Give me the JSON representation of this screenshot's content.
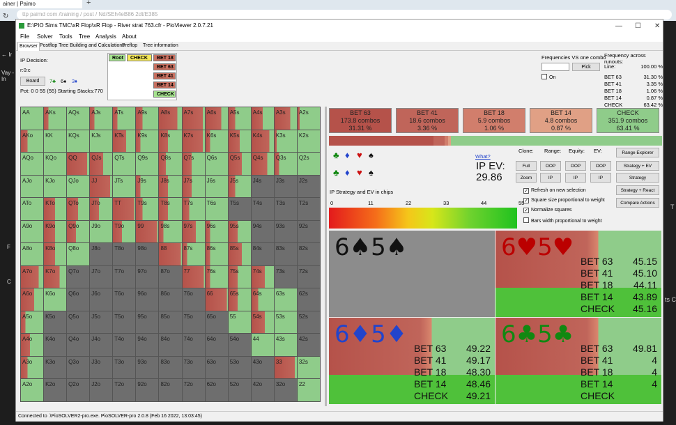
{
  "browser": {
    "tab_title": "ainer | Paimo",
    "url": "ttp  paimd  com /training / post / Nd/SEh4eB86  2dt/E385"
  },
  "left_strip": [
    "← Ir",
    "Vay - In",
    "F",
    "C"
  ],
  "right_strip": [
    "T",
    "ts C"
  ],
  "window": {
    "title": "E:\\PIO Sims TMC\\xR Flop\\xR Flop - River strat 763.cfr - PioViewer 2.0.7.21",
    "controls": [
      "—",
      "☐",
      "✕"
    ]
  },
  "menu": [
    "File",
    "Solver",
    "Tools",
    "Tree",
    "Analysis",
    "About"
  ],
  "tabs": [
    "Browser",
    "Postflop Tree Building and Calculations",
    "Preflop",
    "Tree information"
  ],
  "info": {
    "decision": "IP Decision:",
    "node": "r:0:c",
    "board_btn": "Board",
    "board_cards": [
      "7♣",
      "6♠",
      "3♦"
    ],
    "pot": "Pot: 0 0 55 (55) Starting Stacks:770"
  },
  "tree": {
    "root": "Root",
    "check": "CHECK",
    "bets": [
      "BET 18",
      "BET 63",
      "BET 41",
      "BET 14"
    ],
    "check2": "CHECK"
  },
  "freq_panel": {
    "vs_combo": "Frequencies VS one combo",
    "pick": "Pick",
    "on": "On",
    "across": "Frequency across runouts:",
    "line_label": "Line:",
    "line_value": "100.00 %",
    "rows": [
      {
        "label": "BET 63",
        "value": "31.30 %"
      },
      {
        "label": "BET 41",
        "value": "3.35 %"
      },
      {
        "label": "BET 18",
        "value": "1.06 %"
      },
      {
        "label": "BET 14",
        "value": "0.87 %"
      },
      {
        "label": "CHECK",
        "value": "63.42 %"
      }
    ]
  },
  "hands": [
    [
      "AA",
      "AKs",
      "AQs",
      "AJs",
      "ATs",
      "A9s",
      "A8s",
      "A7s",
      "A6s",
      "A5s",
      "A4s",
      "A3s",
      "A2s"
    ],
    [
      "AKo",
      "KK",
      "KQs",
      "KJs",
      "KTs",
      "K9s",
      "K8s",
      "K7s",
      "K6s",
      "K5s",
      "K4s",
      "K3s",
      "K2s"
    ],
    [
      "AQo",
      "KQo",
      "QQ",
      "QJs",
      "QTs",
      "Q9s",
      "Q8s",
      "Q7s",
      "Q6s",
      "Q5s",
      "Q4s",
      "Q3s",
      "Q2s"
    ],
    [
      "AJo",
      "KJo",
      "QJo",
      "JJ",
      "JTs",
      "J9s",
      "J8s",
      "J7s",
      "J6s",
      "J5s",
      "J4s",
      "J3s",
      "J2s"
    ],
    [
      "ATo",
      "KTo",
      "QTo",
      "JTo",
      "TT",
      "T9s",
      "T8s",
      "T7s",
      "T6s",
      "T5s",
      "T4s",
      "T3s",
      "T2s"
    ],
    [
      "A9o",
      "K9o",
      "Q9o",
      "J9o",
      "T9o",
      "99",
      "98s",
      "97s",
      "96s",
      "95s",
      "94s",
      "93s",
      "92s"
    ],
    [
      "A8o",
      "K8o",
      "Q8o",
      "J8o",
      "T8o",
      "98o",
      "88",
      "87s",
      "86s",
      "85s",
      "84s",
      "83s",
      "82s"
    ],
    [
      "A7o",
      "K7o",
      "Q7o",
      "J7o",
      "T7o",
      "97o",
      "87o",
      "77",
      "76s",
      "75s",
      "74s",
      "73s",
      "72s"
    ],
    [
      "A6o",
      "K6o",
      "Q6o",
      "J6o",
      "T6o",
      "96o",
      "86o",
      "76o",
      "66",
      "65s",
      "64s",
      "63s",
      "62s"
    ],
    [
      "A5o",
      "K5o",
      "Q5o",
      "J5o",
      "T5o",
      "95o",
      "85o",
      "75o",
      "65o",
      "55",
      "54s",
      "53s",
      "52s"
    ],
    [
      "A4o",
      "K4o",
      "Q4o",
      "J4o",
      "T4o",
      "94o",
      "84o",
      "74o",
      "64o",
      "54o",
      "44",
      "43s",
      "42s"
    ],
    [
      "A3o",
      "K3o",
      "Q3o",
      "J3o",
      "T3o",
      "93o",
      "83o",
      "73o",
      "63o",
      "53o",
      "43o",
      "33",
      "32s"
    ],
    [
      "A2o",
      "K2o",
      "Q2o",
      "J2o",
      "T2o",
      "92o",
      "82o",
      "72o",
      "62o",
      "52o",
      "42o",
      "32o",
      "22"
    ]
  ],
  "actions": [
    {
      "label": "BET 63",
      "combos": "173.8 combos",
      "pct": "31.31 %",
      "freq": 31.31,
      "color": "#b5524a"
    },
    {
      "label": "BET 41",
      "combos": "18.6 combos",
      "pct": "3.36 %",
      "freq": 3.36,
      "color": "#c0655a"
    },
    {
      "label": "BET 18",
      "combos": "5.9 combos",
      "pct": "1.06 %",
      "freq": 1.06,
      "color": "#d17e6c"
    },
    {
      "label": "BET 14",
      "combos": "4.8 combos",
      "pct": "0.87 %",
      "freq": 0.87,
      "color": "#e0a085"
    },
    {
      "label": "CHECK",
      "combos": "351.9 combos",
      "pct": "63.41 %",
      "freq": 63.41,
      "color": "#8fcc8a"
    }
  ],
  "mid": {
    "what": "What?",
    "ip_ev_label": "IP EV:",
    "ip_ev_value": "29.86",
    "clone": "Clone:",
    "range": "Range:",
    "equity": "Equity:",
    "ev": "EV:",
    "full": "Full",
    "zoom": "Zoom",
    "oop": "OOP",
    "ip": "IP",
    "range_explorer": "Range Explorer",
    "strategy_ev": "Strategy + EV",
    "strategy": "Strategy",
    "strategy_react": "Strategy + React",
    "compare": "Compare Actions",
    "refresh": "Refresh on new selection",
    "square_size": "Square size proportional to weight",
    "normalize": "Normalize squares",
    "bars_width": "Bars width proportional to weight",
    "strategy_note": "IP Strategy and EV in chips",
    "scale_ticks": [
      "0",
      "11",
      "22",
      "33",
      "44",
      "55"
    ]
  },
  "combos": [
    {
      "cards": "6♠5♠",
      "color": "#111",
      "rows": []
    },
    {
      "cards": "6♥5♥",
      "color": "#b00",
      "rows": [
        {
          "label": "BET 63",
          "ev": "45.15"
        },
        {
          "label": "BET 41",
          "ev": "45.10"
        },
        {
          "label": "BET 18",
          "ev": "44.11"
        },
        {
          "label": "BET 14",
          "ev": "43.89"
        },
        {
          "label": "CHECK",
          "ev": "45.16"
        }
      ]
    },
    {
      "cards": "6♦5♦",
      "color": "#2244cc",
      "rows": [
        {
          "label": "BET 63",
          "ev": "49.22"
        },
        {
          "label": "BET 41",
          "ev": "49.17"
        },
        {
          "label": "BET 18",
          "ev": "48.30"
        },
        {
          "label": "BET 14",
          "ev": "48.46"
        },
        {
          "label": "CHECK",
          "ev": "49.21"
        }
      ]
    },
    {
      "cards": "6♣5♣",
      "color": "#118811",
      "rows": [
        {
          "label": "BET 63",
          "ev": "49.81"
        },
        {
          "label": "BET 41",
          "ev": "4"
        },
        {
          "label": "BET 18",
          "ev": "4"
        },
        {
          "label": "BET 14",
          "ev": "4"
        },
        {
          "label": "CHECK",
          "ev": ""
        }
      ]
    }
  ],
  "status": "Connected to .\\PioSOLVER2-pro.exe. PioSOLVER-pro 2.0.8 (Feb 16 2022, 13:03:45)"
}
